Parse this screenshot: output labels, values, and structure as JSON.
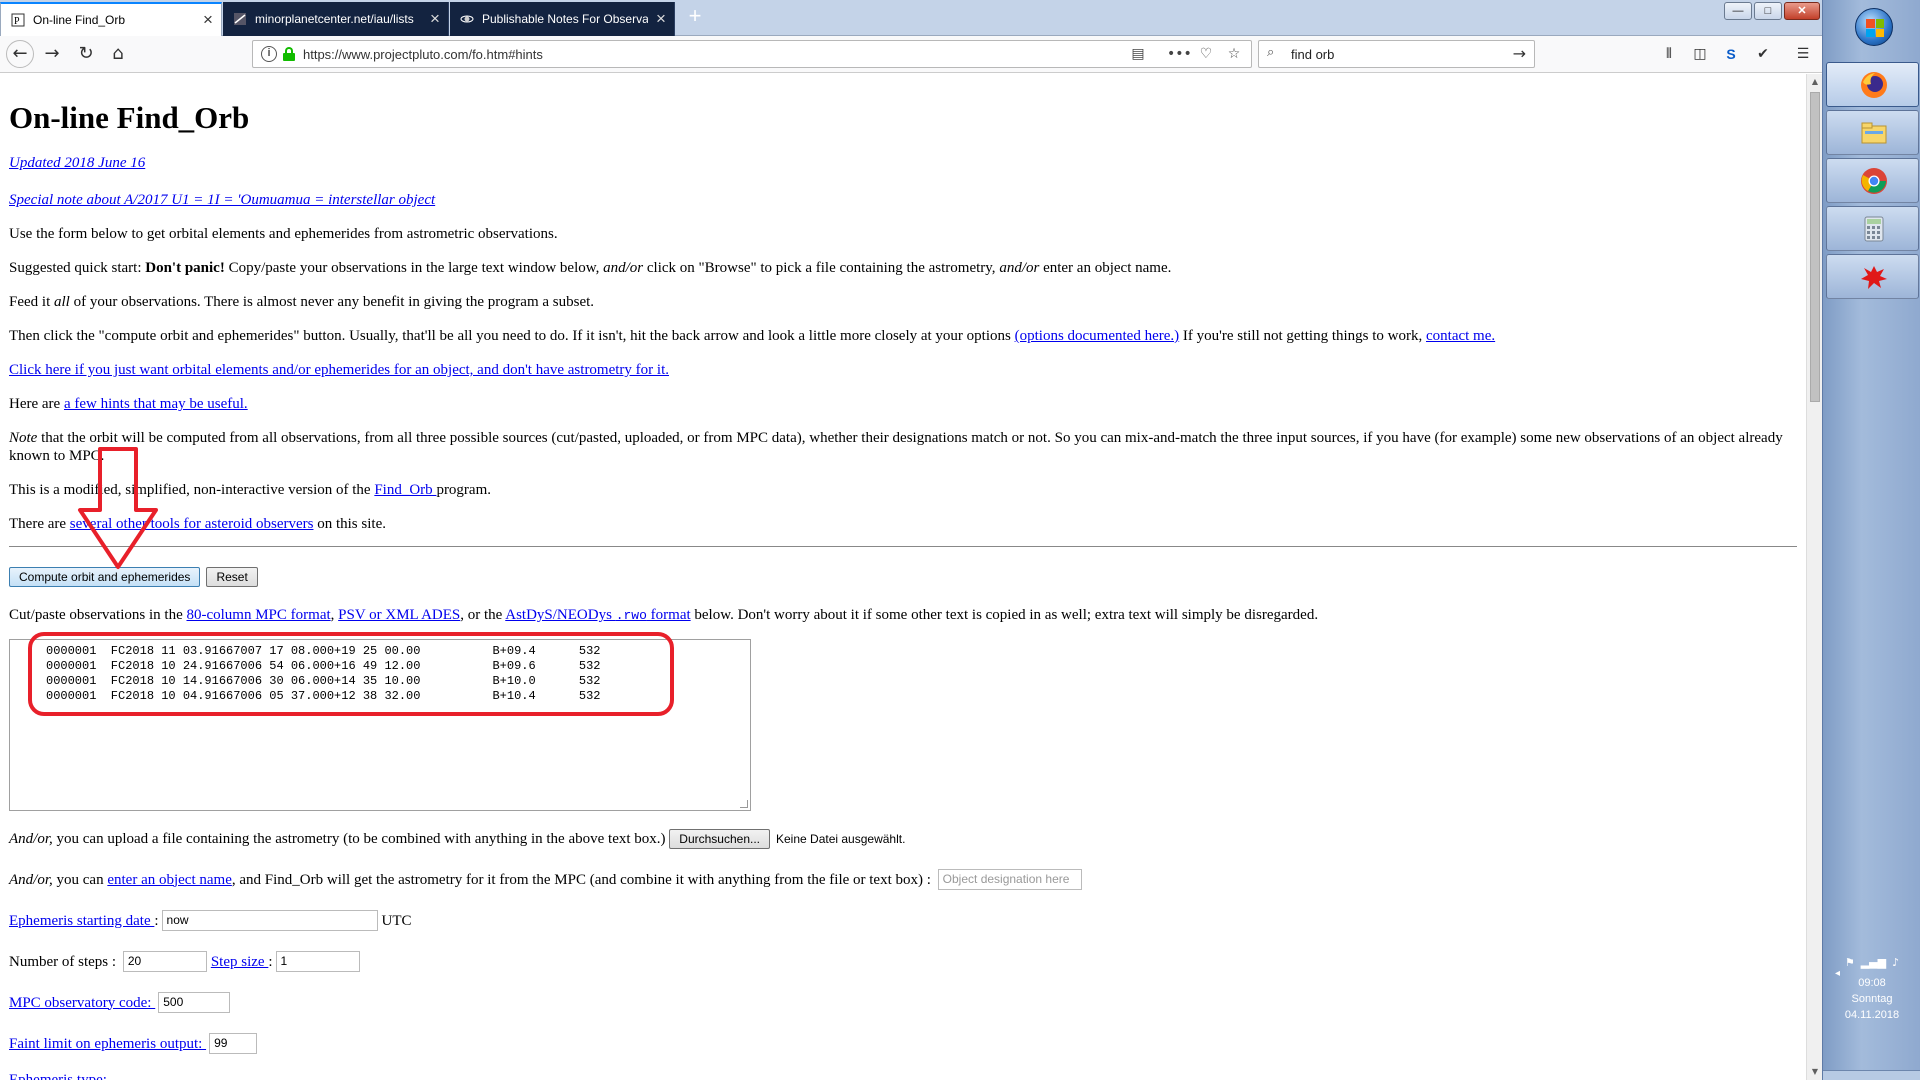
{
  "browser": {
    "tabs": [
      {
        "title": "On-line Find_Orb",
        "active": true
      },
      {
        "title": "minorplanetcenter.net/iau/lists",
        "active": false
      },
      {
        "title": "Publishable Notes For Observat",
        "active": false
      }
    ],
    "url": "https://www.projectpluto.com/fo.htm#hints",
    "search_text": "find orb",
    "window_controls": {
      "minimize": "—",
      "maximize": "□",
      "close": "✕"
    }
  },
  "page": {
    "title": "On-line Find_Orb",
    "updated_link": "Updated 2018 June 16",
    "special_note_link": "Special note about A/2017 U1 = 1I = 'Oumuamua = interstellar object",
    "intro": "Use the form below to get orbital elements and ephemerides from astrometric observations.",
    "quickstart": {
      "prefix": "Suggested quick start: ",
      "bold": "Don't panic!",
      "part1": " Copy/paste your observations in the large text window below, ",
      "andor1": "and/or",
      "part2": " click on \"Browse\" to pick a file containing the astrometry, ",
      "andor2": "and/or",
      "part3": " enter an object name."
    },
    "feed": {
      "prefix": "Feed it ",
      "em": "all",
      "suffix": " of your observations. There is almost never any benefit in giving the program a subset."
    },
    "then_click": {
      "text": "Then click the \"compute orbit and ephemerides\" button. Usually, that'll be all you need to do. If it isn't, hit the back arrow and look a little more closely at your options ",
      "options_link": "(options documented here.)",
      "middle": " If you're still not getting things to work, ",
      "contact_link": "contact me."
    },
    "click_here_link": "Click here if you just want orbital elements and/or ephemerides for an object, and don't have astrometry for it.",
    "hints": {
      "prefix": "Here are ",
      "link": "a few hints that may be useful."
    },
    "note": {
      "em": "Note",
      "text": " that the orbit will be computed from all observations, from all three possible sources (cut/pasted, uploaded, or from MPC data), whether their designations match or not. So you can mix-and-match the three input sources, if you have (for example) some new observations of an object already known to MPC."
    },
    "modified": {
      "prefix": "This is a modified, simplified, non-interactive version of the ",
      "link": "Find_Orb ",
      "suffix": "program."
    },
    "tools": {
      "prefix": "There are ",
      "link": "several other tools for asteroid observers",
      "suffix": " on this site."
    },
    "buttons": {
      "compute": "Compute orbit and ephemerides",
      "reset": "Reset"
    },
    "cutpaste": {
      "prefix": "Cut/paste observations in the ",
      "link1": "80-column MPC format",
      "sep1": ", ",
      "link2": "PSV or XML ADES",
      "sep2": ", or the ",
      "link3a": "AstDyS/NEODys ",
      "link3code": ".rwo",
      "link3b": " format",
      "suffix": " below. Don't worry about it if some other text is copied in as well; extra text will simply be disregarded."
    },
    "observations": [
      "0000001  FC2018 11 03.91667007 17 08.000+19 25 00.00          B+09.4      532",
      "0000001  FC2018 10 24.91667006 54 06.000+16 49 12.00          B+09.6      532",
      "0000001  FC2018 10 14.91667006 30 06.000+14 35 10.00          B+10.0      532",
      "0000001  FC2018 10 04.91667006 05 37.000+12 38 32.00          B+10.4      532"
    ],
    "upload": {
      "em": "And/or,",
      "text": " you can upload a file containing the astrometry (to be combined with anything in the above text box.) ",
      "browse_button": "Durchsuchen...",
      "file_status": "Keine Datei ausgewählt."
    },
    "object_name": {
      "em": "And/or,",
      "prefix": " you can ",
      "link": "enter an object name",
      "suffix": ", and Find_Orb will get the astrometry for it from the MPC (and combine it with anything from the file or text box) : ",
      "placeholder": "Object designation here"
    },
    "ephem_start": {
      "link": "Ephemeris starting date ",
      "sep": ":",
      "value": "now",
      "unit": "UTC"
    },
    "steps": {
      "label": "Number of steps : ",
      "value": "20",
      "stepsize_link": "Step size ",
      "stepsize_sep": ":",
      "stepsize_value": "1"
    },
    "mpc_code": {
      "link": "MPC observatory code: ",
      "value": "500"
    },
    "faint": {
      "link": "Faint limit on ephemeris output: ",
      "value": "99"
    },
    "ephem_type_link": "Ephemeris type:"
  },
  "annotation_colors": {
    "arrow": "#e8202a",
    "highlight": "#e8202a"
  },
  "taskbar": {
    "apps": [
      "firefox-icon",
      "file-explorer-icon",
      "chrome-icon",
      "calculator-icon",
      "red-splat-icon"
    ],
    "time": "09:08",
    "day": "Sonntag",
    "date": "04.11.2018"
  }
}
